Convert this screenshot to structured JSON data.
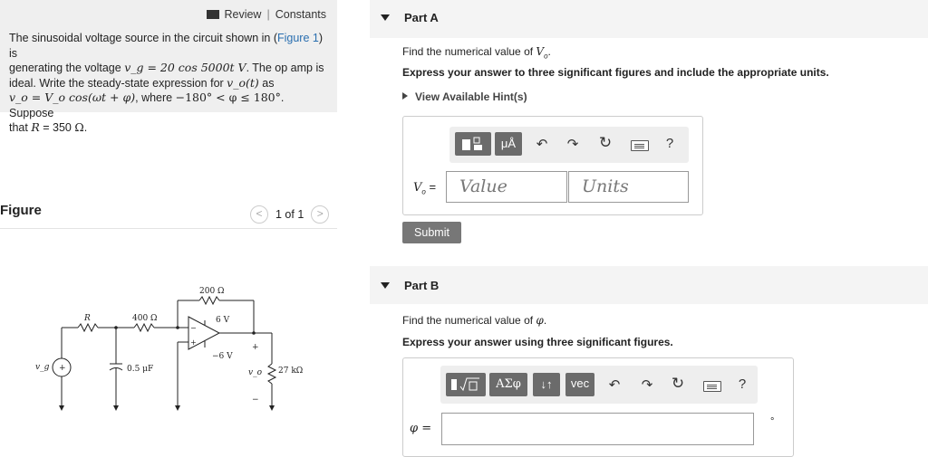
{
  "problem": {
    "review_label": "Review",
    "separator": "|",
    "constants_label": "Constants",
    "line1": "The sinusoidal voltage source in the circuit shown in (",
    "figure_link": "Figure 1",
    "line1_end": ") is",
    "line2_a": "generating the voltage ",
    "line2_math": "v_g = 20 cos 5000t V",
    "line2_b": ". The op amp is",
    "line3_a": "ideal. Write the steady-state expression for ",
    "line3_math": "v_o(t)",
    "line3_b": " as",
    "line4_math": "v_o = V_o cos(ωt + φ)",
    "line4_a": ", where ",
    "line4_range": "−180° < φ ≤ 180°",
    "line4_b": ". Suppose",
    "line5_a": "that ",
    "line5_math": "R",
    "line5_b": " = 350 ",
    "line5_unit": "Ω",
    "line5_end": "."
  },
  "figure": {
    "title": "Figure",
    "pager": "1 of 1",
    "prev_symbol": "<",
    "next_symbol": ">",
    "circuit": {
      "r_label": "R",
      "r400": "400 Ω",
      "r200": "200 Ω",
      "vplus": "6 V",
      "vminus": "−6 V",
      "cap": "0.5 μF",
      "rload": "27 kΩ",
      "vg": "v_g",
      "vo": "v_o",
      "plus": "+",
      "minus": "−"
    }
  },
  "partA": {
    "title": "Part A",
    "instruction": "Find the numerical value of ",
    "instruction_var": "V",
    "instruction_sub": "o",
    "emphasis": "Express your answer to three significant figures and include the appropriate units.",
    "hint": "View Available Hint(s)",
    "label": "V",
    "label_sub": "o",
    "label_eq": " =",
    "value_placeholder": "Value",
    "units_placeholder": "Units",
    "submit": "Submit",
    "toolbar": {
      "units_btn": "μÅ",
      "help": "?"
    }
  },
  "partB": {
    "title": "Part B",
    "instruction": "Find the numerical value of ",
    "instruction_var": "φ",
    "emphasis": "Express your answer using three significant figures.",
    "label": "φ =",
    "degree": "°",
    "toolbar": {
      "symbol_btn": "ΑΣφ",
      "swap_btn": "↓↑",
      "vec_btn": "vec",
      "help": "?"
    }
  }
}
